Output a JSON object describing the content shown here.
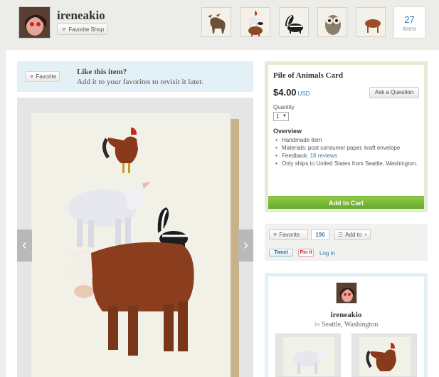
{
  "shop": {
    "name": "ireneakio",
    "favorite_shop_label": "Favorite Shop",
    "items_count": "27",
    "items_label": "items"
  },
  "like": {
    "favorite_label": "Favorite",
    "title": "Like this item?",
    "subtitle": "Add it to your favorites to revisit it later."
  },
  "listing": {
    "title": "Pile of Animals Card",
    "price": "$4.00",
    "currency": "USD",
    "ask_label": "Ask a Question",
    "quantity_label": "Quantity",
    "quantity_value": "1",
    "overview_title": "Overview",
    "overview": {
      "handmade": "Handmade item",
      "materials": "Materials: post consumer paper, kraft envelope",
      "feedback_prefix": "Feedback:",
      "feedback_link": "16 reviews",
      "ships": "Only ships to United States from Seattle, Washington."
    },
    "add_to_cart_label": "Add to Cart"
  },
  "social": {
    "favorite_label": "Favorite",
    "favorite_count": "196",
    "add_to_label": "Add to",
    "tweet_label": "Tweet",
    "pin_label": "Pin it",
    "login_label": "Log In"
  },
  "seller": {
    "name": "ireneakio",
    "location_prefix": "in",
    "location": "Seattle, Washington"
  },
  "icons": {
    "heart": "heart-icon",
    "list": "list-icon",
    "left_arrow": "chevron-left-icon",
    "right_arrow": "chevron-right-icon"
  },
  "colors": {
    "link": "#3d7aa8",
    "cart_green": "#7dbc3a",
    "like_bar": "#e3f0f5",
    "buy_border": "#e4ecd6"
  }
}
